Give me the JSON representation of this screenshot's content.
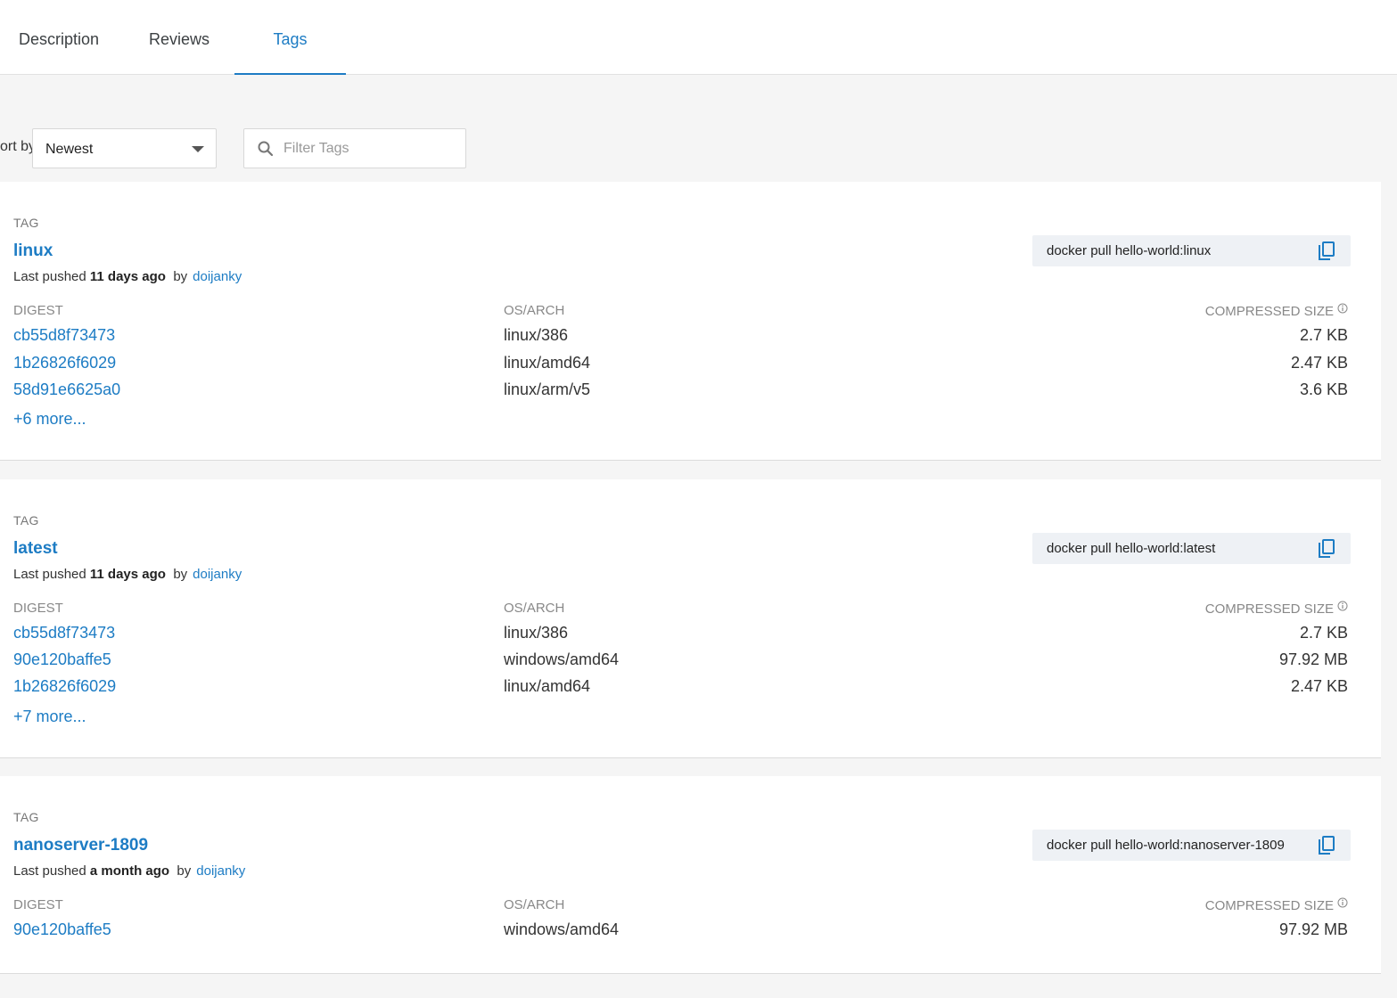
{
  "tabs": [
    {
      "label": "Description"
    },
    {
      "label": "Reviews"
    },
    {
      "label": "Tags"
    }
  ],
  "toolbar": {
    "sort_label": "Sort by",
    "sort_value": "Newest",
    "filter_placeholder": "Filter Tags"
  },
  "labels": {
    "tag": "TAG",
    "digest": "DIGEST",
    "os_arch": "OS/ARCH",
    "compressed_size": "COMPRESSED SIZE",
    "last_pushed": "Last pushed",
    "by": "by"
  },
  "tags": [
    {
      "name": "linux",
      "pushed_ago": "11 days ago",
      "pushed_by": "doijanky",
      "pull_command": "docker pull hello-world:linux",
      "rows": [
        {
          "digest": "cb55d8f73473",
          "arch": "linux/386",
          "size": "2.7 KB"
        },
        {
          "digest": "1b26826f6029",
          "arch": "linux/amd64",
          "size": "2.47 KB"
        },
        {
          "digest": "58d91e6625a0",
          "arch": "linux/arm/v5",
          "size": "3.6 KB"
        }
      ],
      "more": "+6 more..."
    },
    {
      "name": "latest",
      "pushed_ago": "11 days ago",
      "pushed_by": "doijanky",
      "pull_command": "docker pull hello-world:latest",
      "rows": [
        {
          "digest": "cb55d8f73473",
          "arch": "linux/386",
          "size": "2.7 KB"
        },
        {
          "digest": "90e120baffe5",
          "arch": "windows/amd64",
          "size": "97.92 MB"
        },
        {
          "digest": "1b26826f6029",
          "arch": "linux/amd64",
          "size": "2.47 KB"
        }
      ],
      "more": "+7 more..."
    },
    {
      "name": "nanoserver-1809",
      "pushed_ago": "a month ago",
      "pushed_by": "doijanky",
      "pull_command": "docker pull hello-world:nanoserver-1809",
      "rows": [
        {
          "digest": "90e120baffe5",
          "arch": "windows/amd64",
          "size": "97.92 MB"
        }
      ]
    }
  ],
  "colors": {
    "accent": "#1d7cc4",
    "background": "#f5f5f5",
    "card": "#ffffff",
    "pull_box": "#eef1f5"
  }
}
